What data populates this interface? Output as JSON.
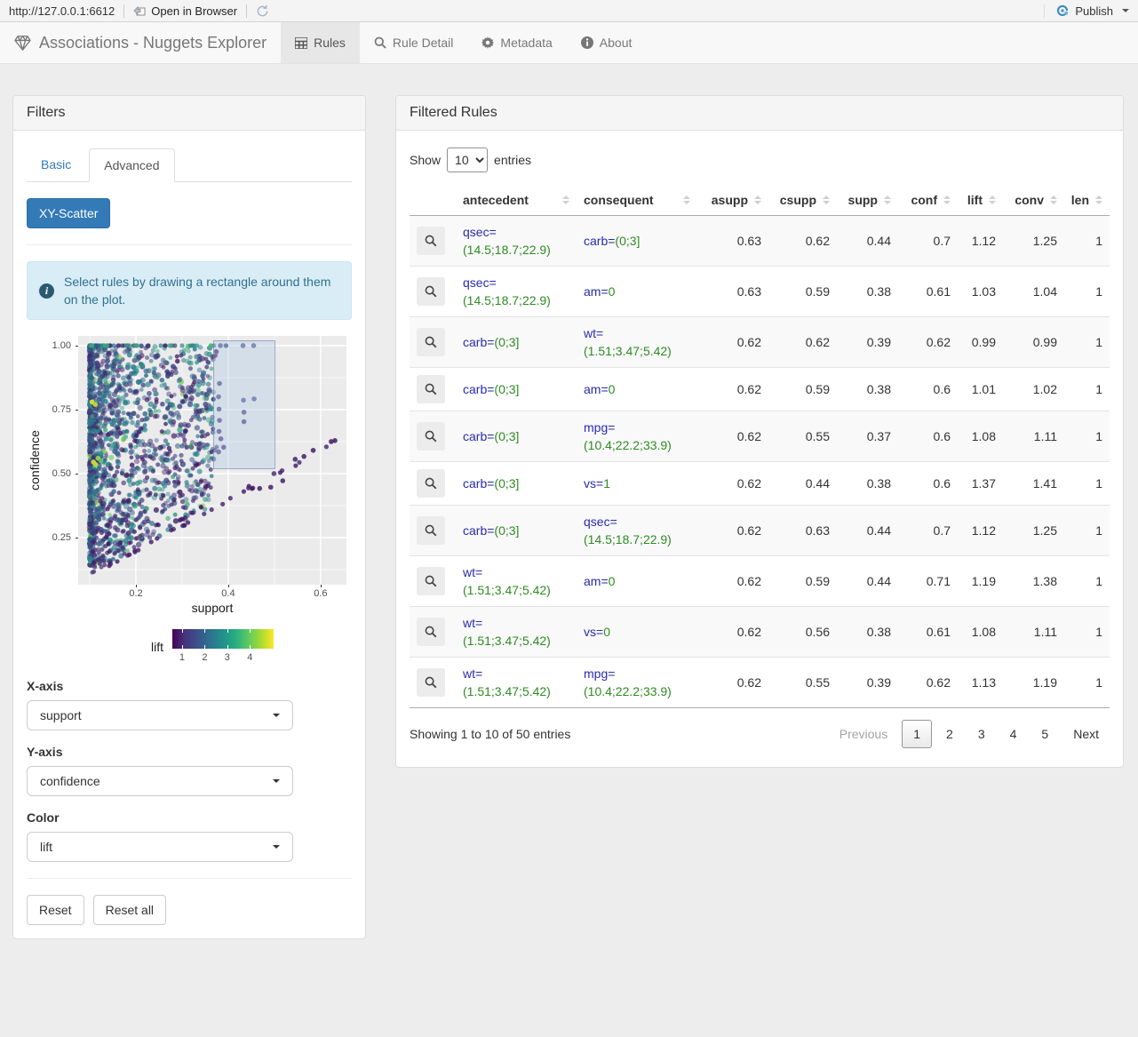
{
  "viewer_bar": {
    "url": "http://127.0.0.1:6612",
    "open_in_browser": "Open in Browser",
    "publish": "Publish",
    "publish_color": "#3d8dc4"
  },
  "navbar": {
    "title": "Associations - Nuggets Explorer",
    "tabs": [
      {
        "label": "Rules",
        "icon": "table-icon",
        "active": true
      },
      {
        "label": "Rule Detail",
        "icon": "search-icon",
        "active": false
      },
      {
        "label": "Metadata",
        "icon": "gear-icon",
        "active": false
      },
      {
        "label": "About",
        "icon": "info-icon",
        "active": false
      }
    ]
  },
  "filters": {
    "title": "Filters",
    "tabs": {
      "basic": "Basic",
      "advanced": "Advanced",
      "active": "Advanced"
    },
    "scatter_button": "XY-Scatter",
    "alert_text": "Select rules by drawing a rectangle around them on the plot.",
    "controls": [
      {
        "label": "X-axis",
        "value": "support"
      },
      {
        "label": "Y-axis",
        "value": "confidence"
      },
      {
        "label": "Color",
        "value": "lift"
      }
    ],
    "reset": "Reset",
    "reset_all": "Reset all"
  },
  "chart_data": {
    "type": "scatter",
    "xlabel": "support",
    "ylabel": "confidence",
    "x_ticks": [
      0.2,
      0.4,
      0.6
    ],
    "x_minor": [
      0.1,
      0.3,
      0.5
    ],
    "y_ticks": [
      0.25,
      0.5,
      0.75,
      1.0
    ],
    "y_tick_labels": [
      "0.25",
      "0.50",
      "0.75",
      "1.00"
    ],
    "y_minor": [
      0.125,
      0.375,
      0.625,
      0.875
    ],
    "xlim": [
      0.075,
      0.656
    ],
    "ylim": [
      0.066,
      1.038
    ],
    "panel_bg": "#ebebeb",
    "grid_color": "#ffffff",
    "selection_rect": {
      "x0": 0.367,
      "y0": 0.517,
      "x1": 0.502,
      "y1": 1.021
    },
    "color_legend": {
      "label": "lift",
      "ticks": [
        1,
        2,
        3,
        4
      ],
      "domain": [
        0.57,
        5.05
      ],
      "palette": [
        "#440154",
        "#3b528b",
        "#21918c",
        "#5ec962",
        "#fde725"
      ]
    },
    "generator": {
      "seed": 13,
      "cloud_n": 1550,
      "top_row_n": 60,
      "streak_slopes": [
        1.08,
        1.22,
        1.38,
        1.6,
        1.85,
        2.15,
        2.6,
        3.2
      ],
      "streak_n": 20,
      "diagonal_n": 30
    },
    "selection_points": [
      [
        0.383,
        1.0,
        1.45
      ],
      [
        0.432,
        1.0,
        1.5
      ],
      [
        0.455,
        1.0,
        1.55
      ],
      [
        0.381,
        0.852,
        1.2
      ],
      [
        0.379,
        0.8,
        1.25
      ],
      [
        0.433,
        0.787,
        1.6
      ],
      [
        0.456,
        0.792,
        1.6
      ],
      [
        0.38,
        0.752,
        1.25
      ],
      [
        0.434,
        0.74,
        1.2
      ],
      [
        0.381,
        0.708,
        1.2
      ],
      [
        0.434,
        0.703,
        1.15
      ],
      [
        0.38,
        0.665,
        1.1
      ],
      [
        0.384,
        0.636,
        1.1
      ],
      [
        0.39,
        0.603,
        1.1
      ],
      [
        0.379,
        0.585,
        1.05
      ],
      [
        0.499,
        0.5,
        1.1
      ]
    ],
    "outlier_points": [
      [
        0.545,
        0.556,
        1.05
      ],
      [
        0.564,
        0.567,
        1.0
      ],
      [
        0.584,
        0.591,
        1.0
      ],
      [
        0.623,
        0.625,
        0.95
      ],
      [
        0.631,
        0.629,
        0.95
      ],
      [
        0.518,
        0.472,
        1.0
      ],
      [
        0.492,
        0.447,
        1.0
      ],
      [
        0.468,
        0.442,
        1.0
      ]
    ],
    "highlight_points": [
      [
        0.105,
        0.78,
        4.9
      ],
      [
        0.112,
        0.77,
        4.7
      ],
      [
        0.108,
        0.545,
        4.8
      ],
      [
        0.113,
        0.535,
        4.6
      ],
      [
        0.118,
        0.56,
        4.4
      ],
      [
        0.124,
        0.55,
        3.9
      ]
    ]
  },
  "rules_table": {
    "title": "Filtered Rules",
    "show_label": "Show",
    "entries_label": "entries",
    "page_length": "10",
    "columns": [
      {
        "label": "antecedent",
        "numeric": false
      },
      {
        "label": "consequent",
        "numeric": false
      },
      {
        "label": "asupp",
        "numeric": true
      },
      {
        "label": "csupp",
        "numeric": true
      },
      {
        "label": "supp",
        "numeric": true
      },
      {
        "label": "conf",
        "numeric": true
      },
      {
        "label": "lift",
        "numeric": true
      },
      {
        "label": "conv",
        "numeric": true
      },
      {
        "label": "len",
        "numeric": true
      }
    ],
    "rows": [
      {
        "antecedent": [
          "qsec=",
          "(14.5;18.7;22.9)"
        ],
        "consequent": [
          "carb=",
          "(0;3]"
        ],
        "values": [
          "0.63",
          "0.62",
          "0.44",
          "0.7",
          "1.12",
          "1.25",
          "1"
        ]
      },
      {
        "antecedent": [
          "qsec=",
          "(14.5;18.7;22.9)"
        ],
        "consequent": [
          "am=",
          "0"
        ],
        "values": [
          "0.63",
          "0.59",
          "0.38",
          "0.61",
          "1.03",
          "1.04",
          "1"
        ]
      },
      {
        "antecedent": [
          "carb=",
          "(0;3]"
        ],
        "consequent": [
          "wt=",
          "(1.51;3.47;5.42)"
        ],
        "values": [
          "0.62",
          "0.62",
          "0.39",
          "0.62",
          "0.99",
          "0.99",
          "1"
        ]
      },
      {
        "antecedent": [
          "carb=",
          "(0;3]"
        ],
        "consequent": [
          "am=",
          "0"
        ],
        "values": [
          "0.62",
          "0.59",
          "0.38",
          "0.6",
          "1.01",
          "1.02",
          "1"
        ]
      },
      {
        "antecedent": [
          "carb=",
          "(0;3]"
        ],
        "consequent": [
          "mpg=",
          "(10.4;22.2;33.9)"
        ],
        "values": [
          "0.62",
          "0.55",
          "0.37",
          "0.6",
          "1.08",
          "1.11",
          "1"
        ]
      },
      {
        "antecedent": [
          "carb=",
          "(0;3]"
        ],
        "consequent": [
          "vs=",
          "1"
        ],
        "values": [
          "0.62",
          "0.44",
          "0.38",
          "0.6",
          "1.37",
          "1.41",
          "1"
        ]
      },
      {
        "antecedent": [
          "carb=",
          "(0;3]"
        ],
        "consequent": [
          "qsec=",
          "(14.5;18.7;22.9)"
        ],
        "values": [
          "0.62",
          "0.63",
          "0.44",
          "0.7",
          "1.12",
          "1.25",
          "1"
        ]
      },
      {
        "antecedent": [
          "wt=",
          "(1.51;3.47;5.42)"
        ],
        "consequent": [
          "am=",
          "0"
        ],
        "values": [
          "0.62",
          "0.59",
          "0.44",
          "0.71",
          "1.19",
          "1.38",
          "1"
        ]
      },
      {
        "antecedent": [
          "wt=",
          "(1.51;3.47;5.42)"
        ],
        "consequent": [
          "vs=",
          "0"
        ],
        "values": [
          "0.62",
          "0.56",
          "0.38",
          "0.61",
          "1.08",
          "1.11",
          "1"
        ]
      },
      {
        "antecedent": [
          "wt=",
          "(1.51;3.47;5.42)"
        ],
        "consequent": [
          "mpg=",
          "(10.4;22.2;33.9)"
        ],
        "values": [
          "0.62",
          "0.55",
          "0.39",
          "0.62",
          "1.13",
          "1.19",
          "1"
        ]
      }
    ],
    "info": "Showing 1 to 10 of 50 entries",
    "pagination": {
      "previous": "Previous",
      "pages": [
        "1",
        "2",
        "3",
        "4",
        "5"
      ],
      "current": "1",
      "next": "Next"
    }
  }
}
